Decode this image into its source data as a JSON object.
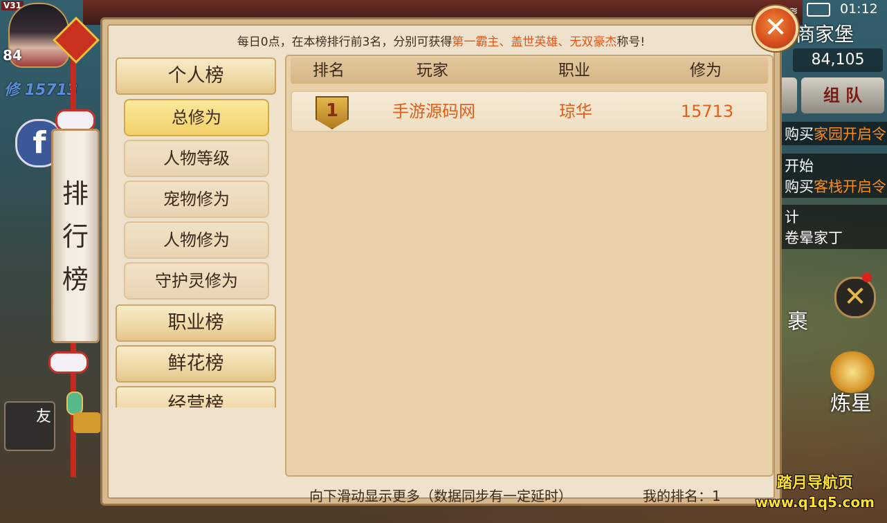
{
  "status": {
    "version": "V31",
    "time": "01:12"
  },
  "player": {
    "level": "84",
    "cultivation_partial": "修 15713"
  },
  "side_banner": {
    "title": "排行榜"
  },
  "hud_right": {
    "location": "商家堡",
    "money": "84,105",
    "team_label": "组 队",
    "notices": [
      {
        "prefix": "购买",
        "highlight": "家园开启令"
      },
      {
        "line1": "开始",
        "prefix": "购买",
        "highlight": "客栈开启令"
      },
      {
        "line1": "计",
        "line2": "卷晕家丁"
      }
    ],
    "bag_label": "裹",
    "refine_label": "炼星",
    "friend_label": "友"
  },
  "panel": {
    "banner": {
      "prefix": "每日0点，在本榜排行前3名，分别可获得",
      "titles": "第一霸主、盖世英雄、无双豪杰",
      "suffix": "称号!"
    },
    "categories": [
      {
        "label": "个人榜"
      },
      {
        "label": "职业榜"
      },
      {
        "label": "鲜花榜"
      },
      {
        "label": "经营榜"
      }
    ],
    "subcategories": [
      {
        "label": "总修为",
        "active": true
      },
      {
        "label": "人物等级"
      },
      {
        "label": "宠物修为"
      },
      {
        "label": "人物修为"
      },
      {
        "label": "守护灵修为"
      }
    ],
    "table": {
      "headers": [
        "排名",
        "玩家",
        "职业",
        "修为"
      ],
      "rows": [
        {
          "rank": "1",
          "player": "手游源码网",
          "profession": "琼华",
          "cultivation": "15713"
        }
      ]
    },
    "footer_hint": "向下滑动显示更多（数据同步有一定延时）",
    "my_rank": "我的排名：1"
  },
  "watermark": {
    "line1": "踏月导航页",
    "line2": "www.q1q5.com"
  },
  "colors": {
    "highlight": "#e2561a",
    "row_text": "#e0601b",
    "close_button": "#d8501e"
  }
}
